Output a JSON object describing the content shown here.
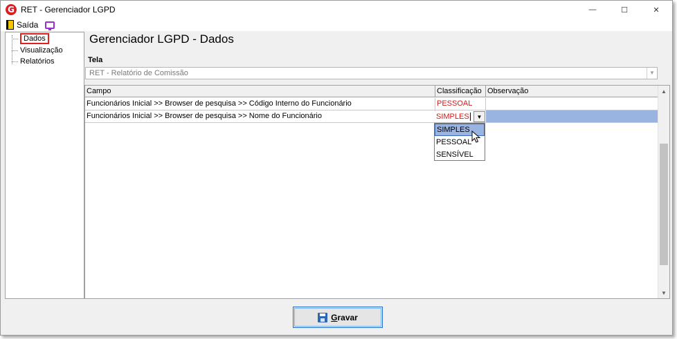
{
  "window": {
    "title": "RET - Gerenciador LGPD",
    "logo_letter": "G",
    "minimize_glyph": "—",
    "maximize_glyph": "☐",
    "close_glyph": "✕"
  },
  "menubar": {
    "exit_label": "Saída"
  },
  "tree": {
    "items": [
      {
        "label": "Dados",
        "selected": true
      },
      {
        "label": "Visualização"
      },
      {
        "label": "Relatórios"
      }
    ]
  },
  "page": {
    "title": "Gerenciador LGPD - Dados"
  },
  "tela": {
    "label": "Tela",
    "value": "RET - Relatório de Comissão"
  },
  "grid": {
    "headers": {
      "campo": "Campo",
      "classificacao": "Classificação",
      "observacao": "Observação"
    },
    "rows": [
      {
        "campo": "Funcionários Inicial >> Browser de pesquisa >> Código Interno do Funcionário",
        "classificacao": "PESSOAL",
        "observacao": ""
      },
      {
        "campo": "Funcionários Inicial >> Browser de pesquisa >> Nome do Funcionário",
        "classificacao": "SIMPLES",
        "observacao": ""
      }
    ]
  },
  "dropdown": {
    "options": [
      "SIMPLES",
      "PESSOAL",
      "SENSÍVEL"
    ],
    "highlighted": "SIMPLES"
  },
  "save_button": {
    "hotkey": "G",
    "rest": "ravar"
  },
  "colors": {
    "accent_red": "#d11a1a",
    "selection_blue": "#99b4e0",
    "highlight_box": "#e0201e",
    "save_icon": "#2c67b8"
  },
  "icons": [
    "app-logo-icon",
    "exit-door-icon",
    "screen-icon",
    "floppy-disk-icon",
    "dropdown-arrow-icon",
    "mouse-pointer-icon"
  ]
}
